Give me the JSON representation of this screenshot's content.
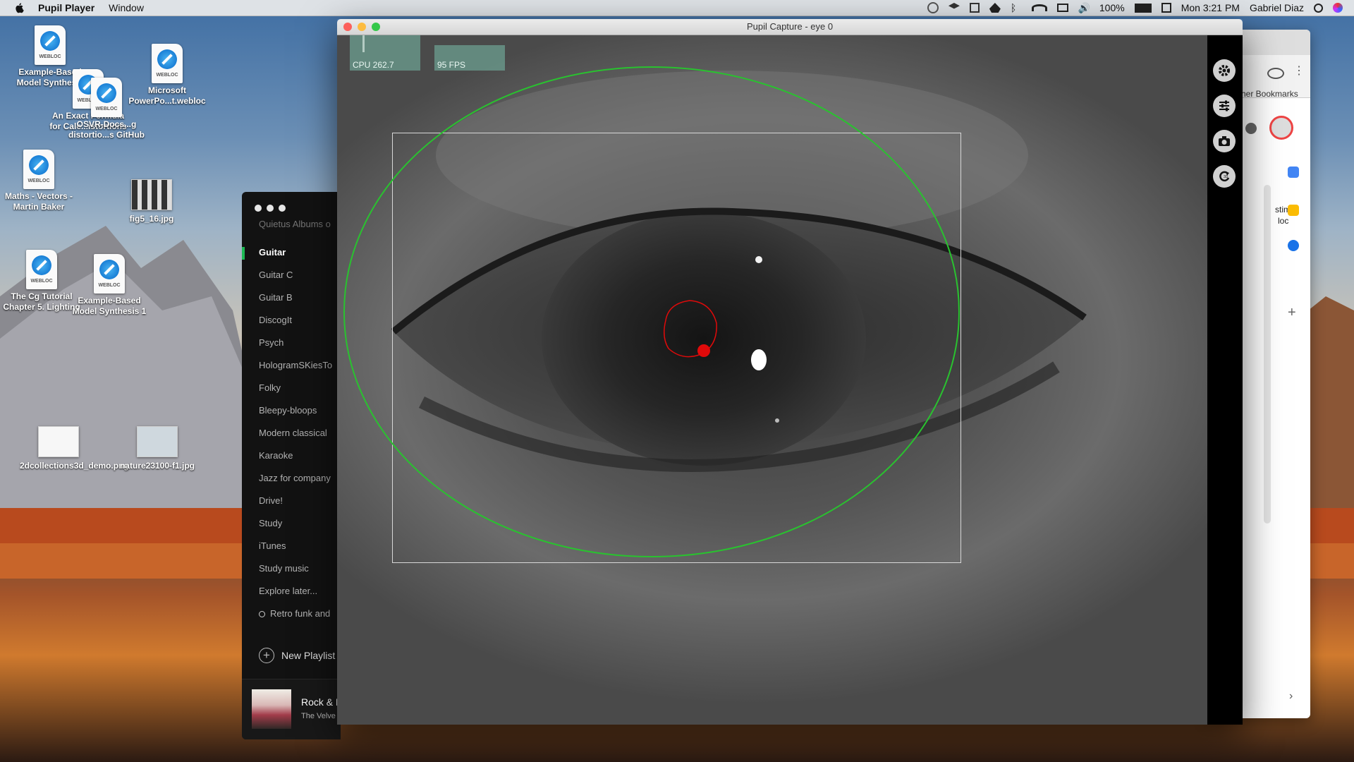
{
  "menubar": {
    "app_name": "Pupil Player",
    "menus": [
      "Window"
    ],
    "battery": "100%",
    "clock": "Mon 3:21 PM",
    "user": "Gabriel Diaz"
  },
  "desktop_icons": [
    {
      "label": "Example-Based Model Synthesis",
      "type": "webloc",
      "tag": "WEBLOC"
    },
    {
      "label": "Microsoft PowerPo...t.webloc",
      "type": "webloc",
      "tag": "WEBLOC"
    },
    {
      "label": "An Exact Formula for Calc...istortions",
      "type": "webloc",
      "tag": "WEBLOC"
    },
    {
      "label": "OSVR-Docs...g distortio...s GitHub",
      "type": "webloc",
      "tag": "WEBLOC"
    },
    {
      "label": "Maths - Vectors - Martin Baker",
      "type": "webloc",
      "tag": "WEBLOC"
    },
    {
      "label": "fig5_16.jpg",
      "type": "image"
    },
    {
      "label": "The Cg Tutorial Chapter 5. Lighting",
      "type": "webloc",
      "tag": "WEBLOC"
    },
    {
      "label": "Example-Based Model Synthesis 1",
      "type": "webloc",
      "tag": "WEBLOC"
    },
    {
      "label": "2dcollections3d_demo.png",
      "type": "image"
    },
    {
      "label": "nature23100-f1.jpg",
      "type": "image"
    }
  ],
  "spotify": {
    "playlists": [
      "Quietus Albums o",
      "Guitar",
      "Guitar C",
      "Guitar B",
      "DiscogIt",
      "Psych",
      "HologramSKiesTo",
      "Folky",
      "Bleepy-bloops",
      "Modern classical",
      "Karaoke",
      "Jazz for company",
      "Drive!",
      "Study",
      "iTunes",
      "Study music",
      "Explore later...",
      "Retro funk and"
    ],
    "active_playlist": "Guitar",
    "new_playlist_label": "New Playlist",
    "now_playing": {
      "title": "Rock & R",
      "artist": "The Velve"
    }
  },
  "chrome": {
    "bookmarks_label": "her Bookmarks",
    "partial_text_1": "stim",
    "partial_text_2": "loc"
  },
  "pupil_capture": {
    "window_title": "Pupil Capture - eye 0",
    "cpu_label": "CPU 262.7",
    "fps_label": "95 FPS",
    "sidebar_icons": [
      "gear-icon",
      "sliders-icon",
      "camera-icon",
      "refresh-3d-icon"
    ],
    "colors": {
      "eye_model": "#29c22f",
      "pupil": "#e00a0a",
      "roi": "#d8d8d8"
    }
  }
}
